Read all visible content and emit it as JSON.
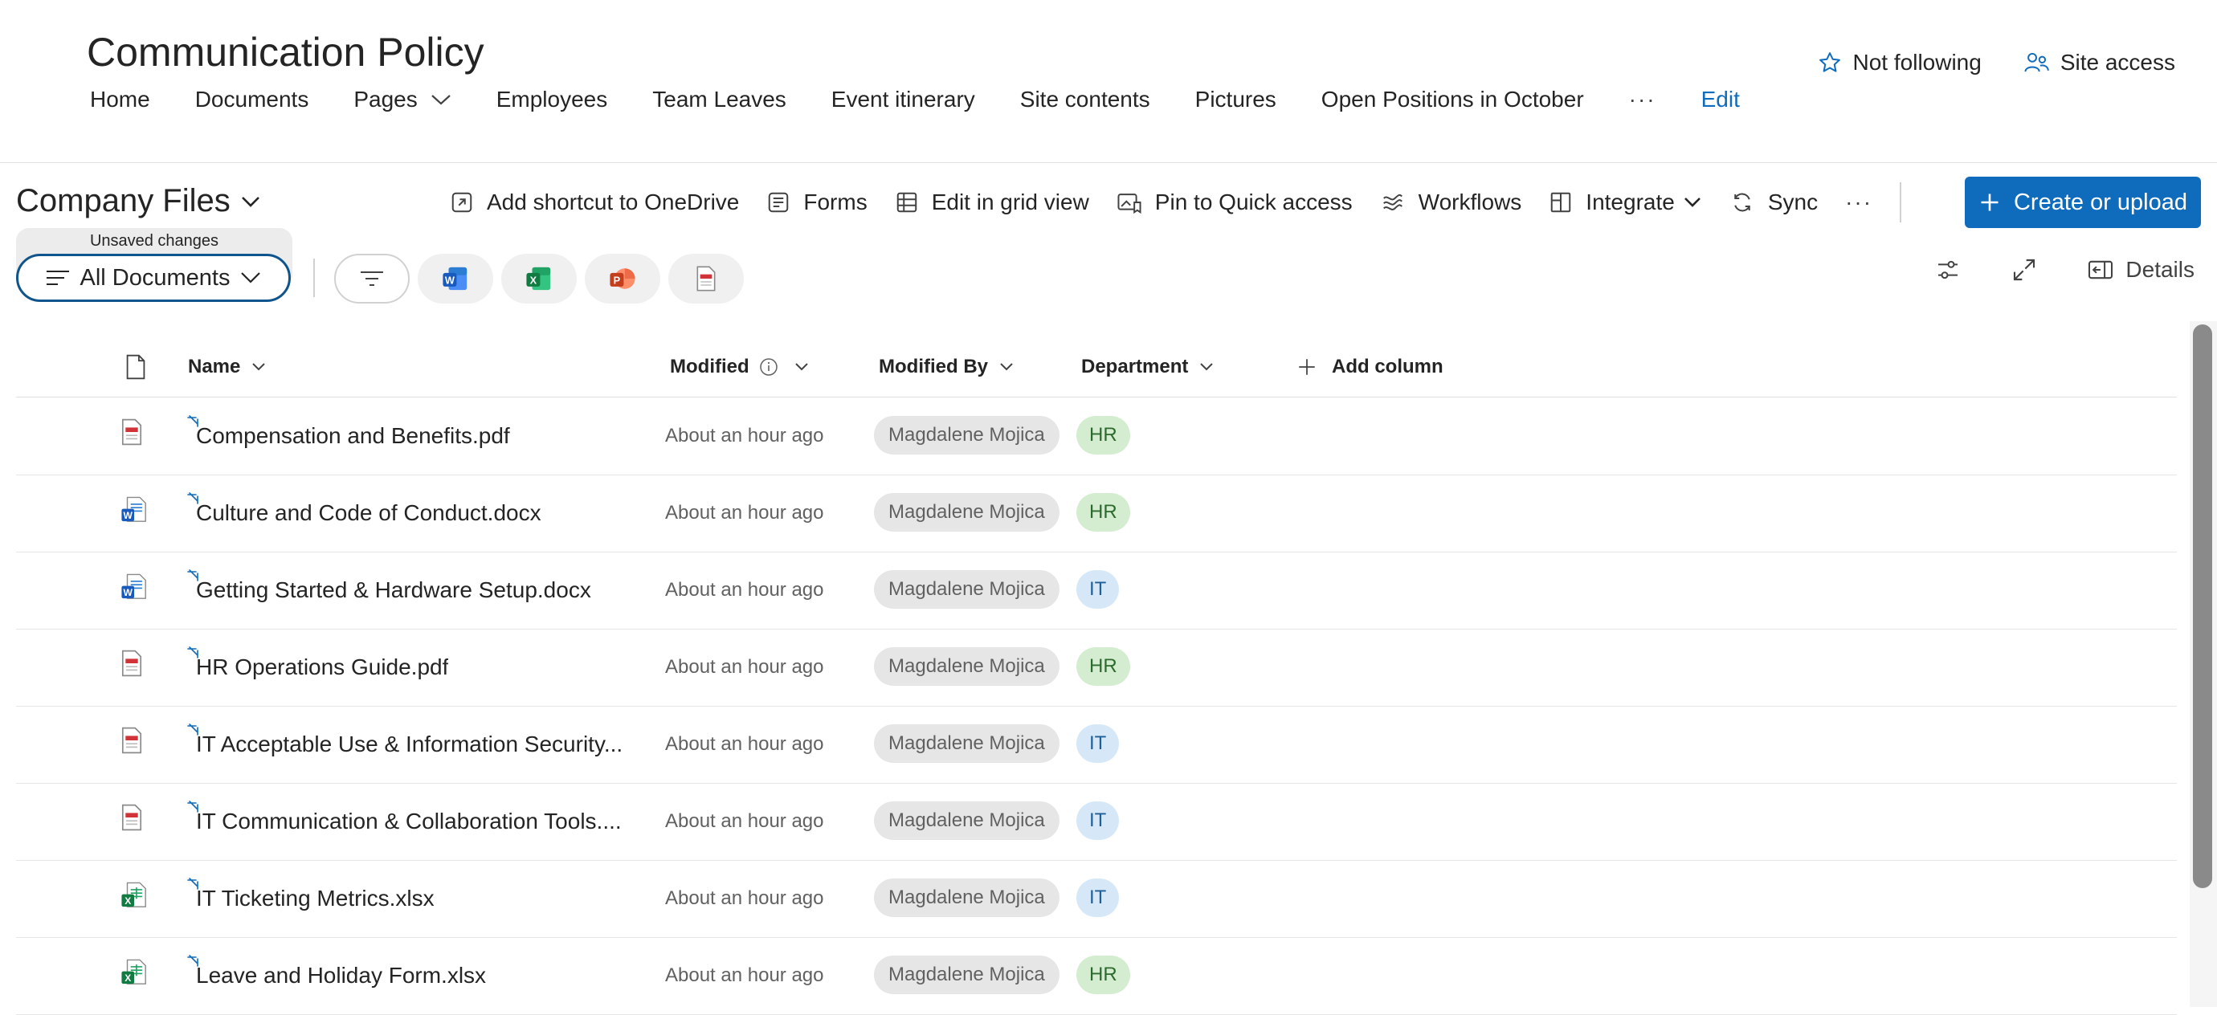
{
  "site": {
    "title": "Communication Policy",
    "nav": [
      {
        "label": "Home"
      },
      {
        "label": "Documents"
      },
      {
        "label": "Pages"
      },
      {
        "label": "Employees"
      },
      {
        "label": "Team Leaves"
      },
      {
        "label": "Event itinerary"
      },
      {
        "label": "Site contents"
      },
      {
        "label": "Pictures"
      },
      {
        "label": "Open Positions in October"
      }
    ],
    "nav_more": "···",
    "nav_edit": "Edit",
    "follow_label": "Not following",
    "access_label": "Site access"
  },
  "library": {
    "title": "Company Files"
  },
  "commands": {
    "shortcut": "Add shortcut to OneDrive",
    "forms": "Forms",
    "grid": "Edit in grid view",
    "pin": "Pin to Quick access",
    "workflows": "Workflows",
    "integrate": "Integrate",
    "sync": "Sync",
    "more": "···",
    "create": "Create or upload"
  },
  "view": {
    "unsaved": "Unsaved changes",
    "name": "All Documents",
    "details": "Details"
  },
  "columns": {
    "name": "Name",
    "modified": "Modified",
    "modified_by": "Modified By",
    "department": "Department",
    "add_column": "Add column"
  },
  "rows": [
    {
      "icon": "pdf-icon",
      "name": "Compensation and Benefits.pdf",
      "modified": "About an hour ago",
      "modified_by": "Magdalene Mojica",
      "department": "HR"
    },
    {
      "icon": "word-icon",
      "name": "Culture and Code of Conduct.docx",
      "modified": "About an hour ago",
      "modified_by": "Magdalene Mojica",
      "department": "HR"
    },
    {
      "icon": "word-icon",
      "name": "Getting Started & Hardware Setup.docx",
      "modified": "About an hour ago",
      "modified_by": "Magdalene Mojica",
      "department": "IT"
    },
    {
      "icon": "pdf-icon",
      "name": "HR Operations Guide.pdf",
      "modified": "About an hour ago",
      "modified_by": "Magdalene Mojica",
      "department": "HR"
    },
    {
      "icon": "pdf-icon",
      "name": "IT Acceptable Use & Information Security...",
      "modified": "About an hour ago",
      "modified_by": "Magdalene Mojica",
      "department": "IT"
    },
    {
      "icon": "pdf-icon",
      "name": "IT Communication & Collaboration Tools....",
      "modified": "About an hour ago",
      "modified_by": "Magdalene Mojica",
      "department": "IT"
    },
    {
      "icon": "excel-icon",
      "name": "IT Ticketing Metrics.xlsx",
      "modified": "About an hour ago",
      "modified_by": "Magdalene Mojica",
      "department": "IT"
    },
    {
      "icon": "excel-icon",
      "name": "Leave and Holiday Form.xlsx",
      "modified": "About an hour ago",
      "modified_by": "Magdalene Mojica",
      "department": "HR"
    }
  ],
  "colors": {
    "accent": "#0f6cbd",
    "hr_pill": "#d4edd0",
    "it_pill": "#d6e8f8"
  }
}
